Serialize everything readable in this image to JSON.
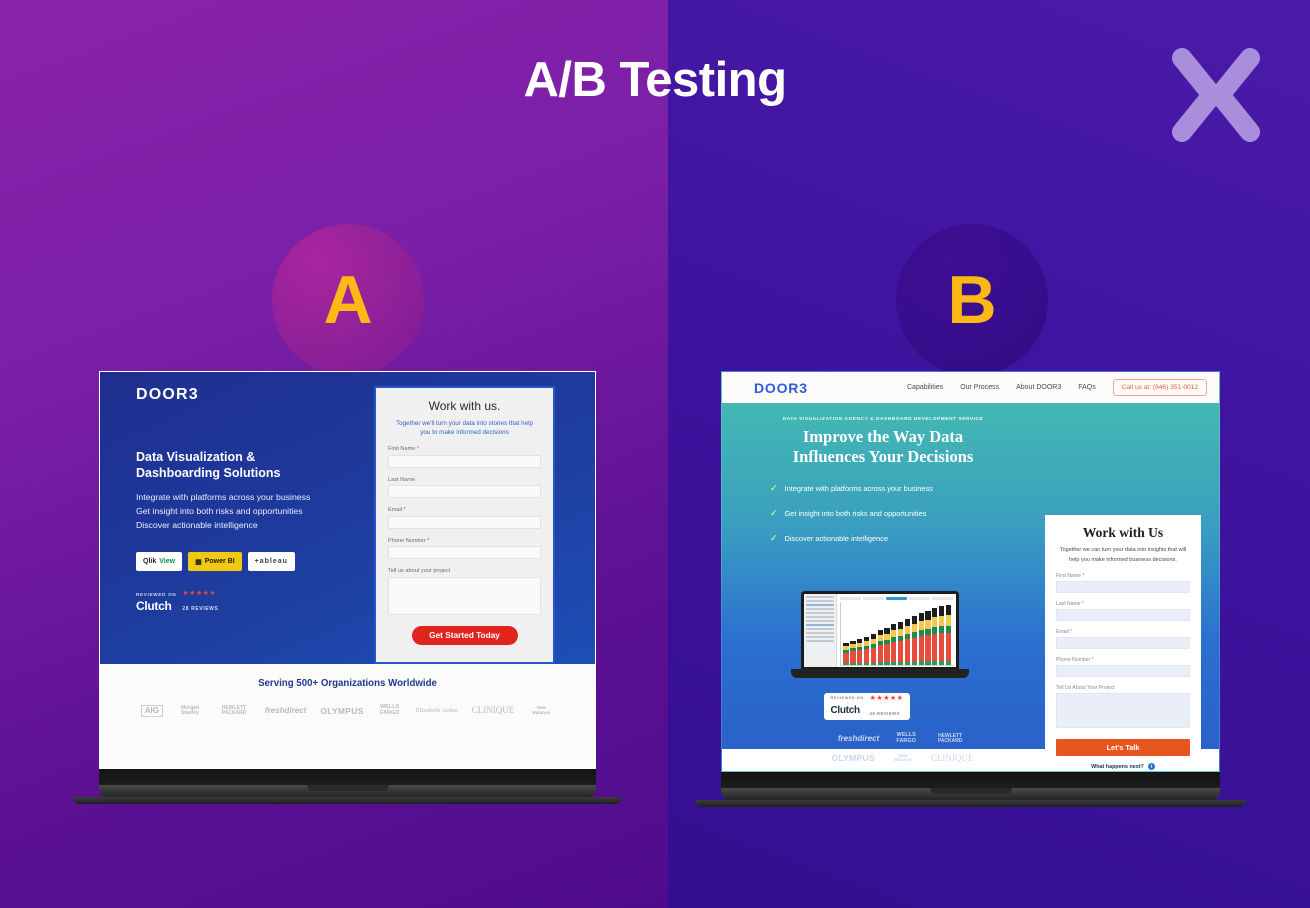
{
  "header": {
    "title": "A/B Testing",
    "logo_icon": "x-chevrons-logo"
  },
  "colors": {
    "bg_left": "#7a1fa6",
    "bg_right": "#3f14a0",
    "letter_accent": "#FDB913",
    "cta_a": "#e2241f",
    "cta_b": "#e8561f",
    "brand_blue": "#2b5fd9"
  },
  "variants": [
    {
      "id": "A",
      "label": "A"
    },
    {
      "id": "B",
      "label": "B"
    }
  ],
  "variant_a": {
    "logo": "DOOR3",
    "headline_line1": "Data Visualization &",
    "headline_line2": "Dashboarding Solutions",
    "bullets": [
      "Integrate with platforms across your business",
      "Get insight into both risks and opportunities",
      "Discover actionable intelligence"
    ],
    "tech_badges": [
      {
        "name": "QlikView",
        "prefix": "Qlik",
        "suffix": "View"
      },
      {
        "name": "Power BI",
        "label": "Power BI"
      },
      {
        "name": "Tableau",
        "label": "+ableau"
      }
    ],
    "clutch": {
      "reviewed_on": "REVIEWED ON",
      "name": "Clutch",
      "stars": "★★★★★",
      "count": "28 REVIEWS"
    },
    "form": {
      "title": "Work with us.",
      "subtitle": "Together we'll turn your data into stories that help you to make informed decisions",
      "fields": [
        {
          "label": "First Name *",
          "value": "",
          "type": "text"
        },
        {
          "label": "Last Name",
          "value": "",
          "type": "text"
        },
        {
          "label": "Email *",
          "value": "",
          "type": "text"
        },
        {
          "label": "Phone Number *",
          "value": "",
          "type": "text"
        },
        {
          "label": "Tell us about your project",
          "value": "",
          "type": "textarea"
        }
      ],
      "cta": "Get Started Today"
    },
    "logos_section": {
      "title": "Serving 500+ Organizations Worldwide",
      "logos": [
        "AIG",
        "Morgan Stanley",
        "HEWLETT PACKARD",
        "freshdirect",
        "OLYMPUS",
        "WELLS FARGO",
        "Elizabeth Arden",
        "CLINIQUE",
        "New Balance"
      ]
    }
  },
  "variant_b": {
    "logo": "DOOR3",
    "nav": [
      "Capabilities",
      "Our Process",
      "About DOOR3",
      "FAQs"
    ],
    "nav_cta": "Call us at: (646) 351-0012",
    "eyebrow": "DATA VISUALIZATION AGENCY & DASHBOARD DEVELOPMENT SERVICE",
    "headline_line1": "Improve the Way Data",
    "headline_line2": "Influences Your Decisions",
    "bullets": [
      "Integrate with platforms across your business",
      "Get insight into both risks and opportunities",
      "Discover actionable intelligence"
    ],
    "clutch": {
      "reviewed_on": "REVIEWED ON",
      "name": "Clutch",
      "stars": "★★★★★",
      "count": "28 REVIEWS"
    },
    "form": {
      "title": "Work with Us",
      "subtitle": "Together we can turn your data into insights that will help you make informed business decisions.",
      "fields": [
        {
          "label": "First Name *",
          "value": "",
          "type": "text"
        },
        {
          "label": "Last Name *",
          "value": "",
          "type": "text"
        },
        {
          "label": "Email *",
          "value": "",
          "type": "text"
        },
        {
          "label": "Phone Number *",
          "value": "",
          "type": "text"
        },
        {
          "label": "Tell Us About Your Project",
          "value": "",
          "type": "textarea"
        }
      ],
      "cta": "Let's Talk",
      "help_link": "What happens next?"
    },
    "logos_row1": [
      "freshdirect",
      "WELLS FARGO",
      "HEWLETT PACKARD"
    ],
    "logos_row2": [
      "OLYMPUS",
      "New Balance",
      "CLINIQUE"
    ],
    "dashboard_mock": {
      "alt": "laptop showing stacked bar chart dashboard"
    }
  }
}
